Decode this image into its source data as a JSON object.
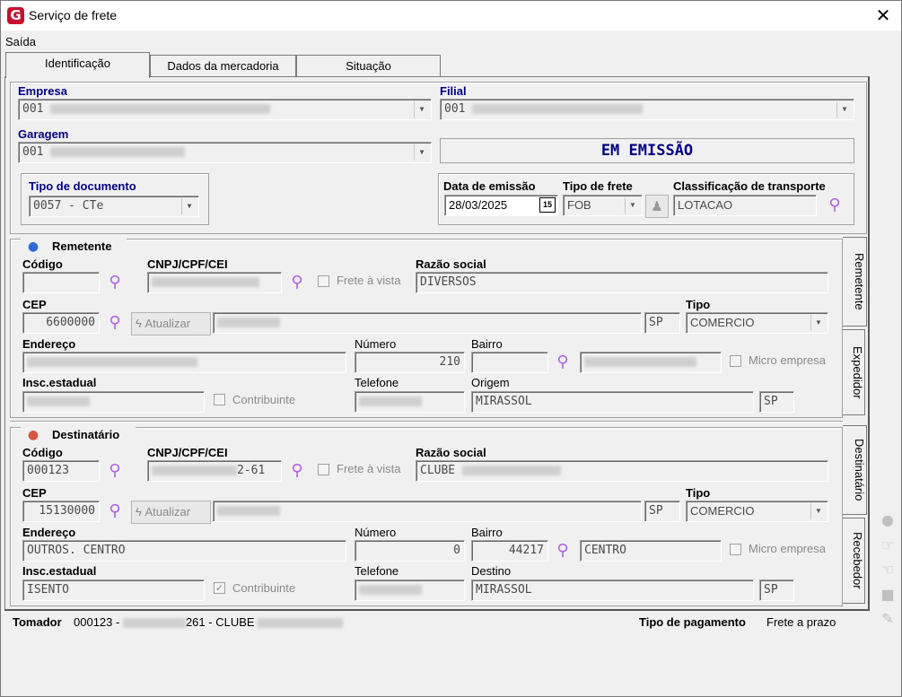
{
  "window": {
    "title": "Serviço de frete",
    "close": "✕",
    "logo": "G"
  },
  "menu": {
    "saida": "Saída"
  },
  "tabs": [
    "Identificação",
    "Dados da mercadoria",
    "Situação"
  ],
  "ident": {
    "empresa_label": "Empresa",
    "empresa_code": "001",
    "filial_label": "Filial",
    "filial_code": "001",
    "garagem_label": "Garagem",
    "garagem_code": "001",
    "status": "EM EMISSÃO",
    "tipo_doc_label": "Tipo de documento",
    "tipo_doc_value": "0057 - CTe",
    "data_emissao_label": "Data de emissão",
    "data_emissao_value": "28/03/2025",
    "cal_icon": "15",
    "tipo_frete_label": "Tipo de frete",
    "tipo_frete_value": "FOB",
    "classif_label": "Classificação de transporte",
    "classif_value": "LOTACAO"
  },
  "remetente": {
    "title": "Remetente",
    "codigo_label": "Código",
    "codigo_value": "",
    "cnpj_label": "CNPJ/CPF/CEI",
    "frete_vista": "Frete à vista",
    "razao_label": "Razão social",
    "razao_value": "DIVERSOS",
    "cep_label": "CEP",
    "cep_value": "6600000",
    "atualizar": "Atualizar",
    "uf": "SP",
    "tipo_label": "Tipo",
    "tipo_value": "COMERCIO",
    "endereco_label": "Endereço",
    "numero_label": "Número",
    "numero_value": "210",
    "bairro_label": "Bairro",
    "micro": "Micro empresa",
    "insc_label": "Insc.estadual",
    "contribuinte": "Contribuinte",
    "telefone_label": "Telefone",
    "origem_label": "Origem",
    "origem_value": "MIRASSOL",
    "origem_uf": "SP"
  },
  "destinatario": {
    "title": "Destinatário",
    "codigo_label": "Código",
    "codigo_value": "000123",
    "cnpj_label": "CNPJ/CPF/CEI",
    "cnpj_suffix": "2-61",
    "frete_vista": "Frete à vista",
    "razao_label": "Razão social",
    "razao_value": "CLUBE",
    "cep_label": "CEP",
    "cep_value": "15130000",
    "atualizar": "Atualizar",
    "uf": "SP",
    "tipo_label": "Tipo",
    "tipo_value": "COMERCIO",
    "endereco_label": "Endereço",
    "endereco_value": "OUTROS. CENTRO",
    "numero_label": "Número",
    "numero_value": "0",
    "bairro_label": "Bairro",
    "bairro_value": "44217",
    "bairro_nome": "CENTRO",
    "micro": "Micro empresa",
    "insc_label": "Insc.estadual",
    "insc_value": "ISENTO",
    "contribuinte": "Contribuinte",
    "contribuinte_check": "✓",
    "telefone_label": "Telefone",
    "destino_label": "Destino",
    "destino_value": "MIRASSOL",
    "destino_uf": "SP"
  },
  "sidetabs": [
    "Remetente",
    "Expedidor",
    "Destinatário",
    "Recebedor"
  ],
  "footer": {
    "tomador_label": "Tomador",
    "tomador_code": "000123 -",
    "tomador_mid": "261 - CLUBE",
    "pagamento_label": "Tipo de pagamento",
    "pagamento_value": "Frete a prazo"
  }
}
